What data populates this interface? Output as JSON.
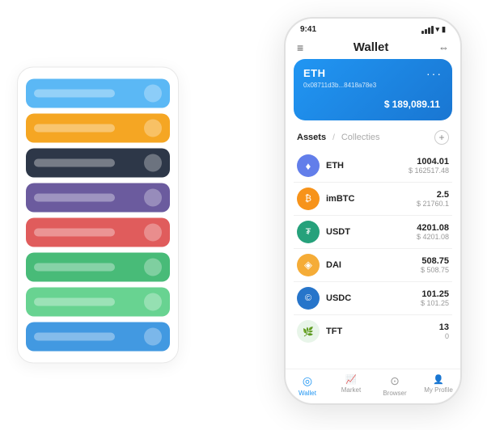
{
  "page": {
    "background": "#ffffff"
  },
  "leftCard": {
    "rows": [
      {
        "color": "blue",
        "class": "row-blue"
      },
      {
        "color": "orange",
        "class": "row-orange"
      },
      {
        "color": "dark",
        "class": "row-dark"
      },
      {
        "color": "purple",
        "class": "row-purple"
      },
      {
        "color": "red",
        "class": "row-red"
      },
      {
        "color": "green",
        "class": "row-green"
      },
      {
        "color": "lightgreen",
        "class": "row-lightgreen"
      },
      {
        "color": "teal",
        "class": "row-teal"
      }
    ]
  },
  "phone": {
    "statusBar": {
      "time": "9:41"
    },
    "header": {
      "title": "Wallet"
    },
    "ethCard": {
      "label": "ETH",
      "address": "0x08711d3b...8418a78e3",
      "amount": "189,089.11",
      "currency": "$"
    },
    "assetsTabs": {
      "active": "Assets",
      "divider": "/",
      "inactive": "Collecties"
    },
    "assets": [
      {
        "name": "ETH",
        "amount": "1004.01",
        "usd": "$ 162517.48",
        "icon": "♦",
        "iconBg": "#627eea",
        "iconColor": "#fff"
      },
      {
        "name": "imBTC",
        "amount": "2.5",
        "usd": "$ 21760.1",
        "icon": "₿",
        "iconBg": "#f7931a",
        "iconColor": "#fff"
      },
      {
        "name": "USDT",
        "amount": "4201.08",
        "usd": "$ 4201.08",
        "icon": "₮",
        "iconBg": "#26a17b",
        "iconColor": "#fff"
      },
      {
        "name": "DAI",
        "amount": "508.75",
        "usd": "$ 508.75",
        "icon": "◈",
        "iconBg": "#f5ac37",
        "iconColor": "#fff"
      },
      {
        "name": "USDC",
        "amount": "101.25",
        "usd": "$ 101.25",
        "icon": "©",
        "iconBg": "#2775ca",
        "iconColor": "#fff"
      },
      {
        "name": "TFT",
        "amount": "13",
        "usd": "0",
        "icon": "🌿",
        "iconBg": "#e8f5e9",
        "iconColor": "#333"
      }
    ],
    "nav": [
      {
        "label": "Wallet",
        "icon": "◎",
        "active": true
      },
      {
        "label": "Market",
        "icon": "📊",
        "active": false
      },
      {
        "label": "Browser",
        "icon": "⊙",
        "active": false
      },
      {
        "label": "My Profile",
        "icon": "👤",
        "active": false
      }
    ]
  }
}
